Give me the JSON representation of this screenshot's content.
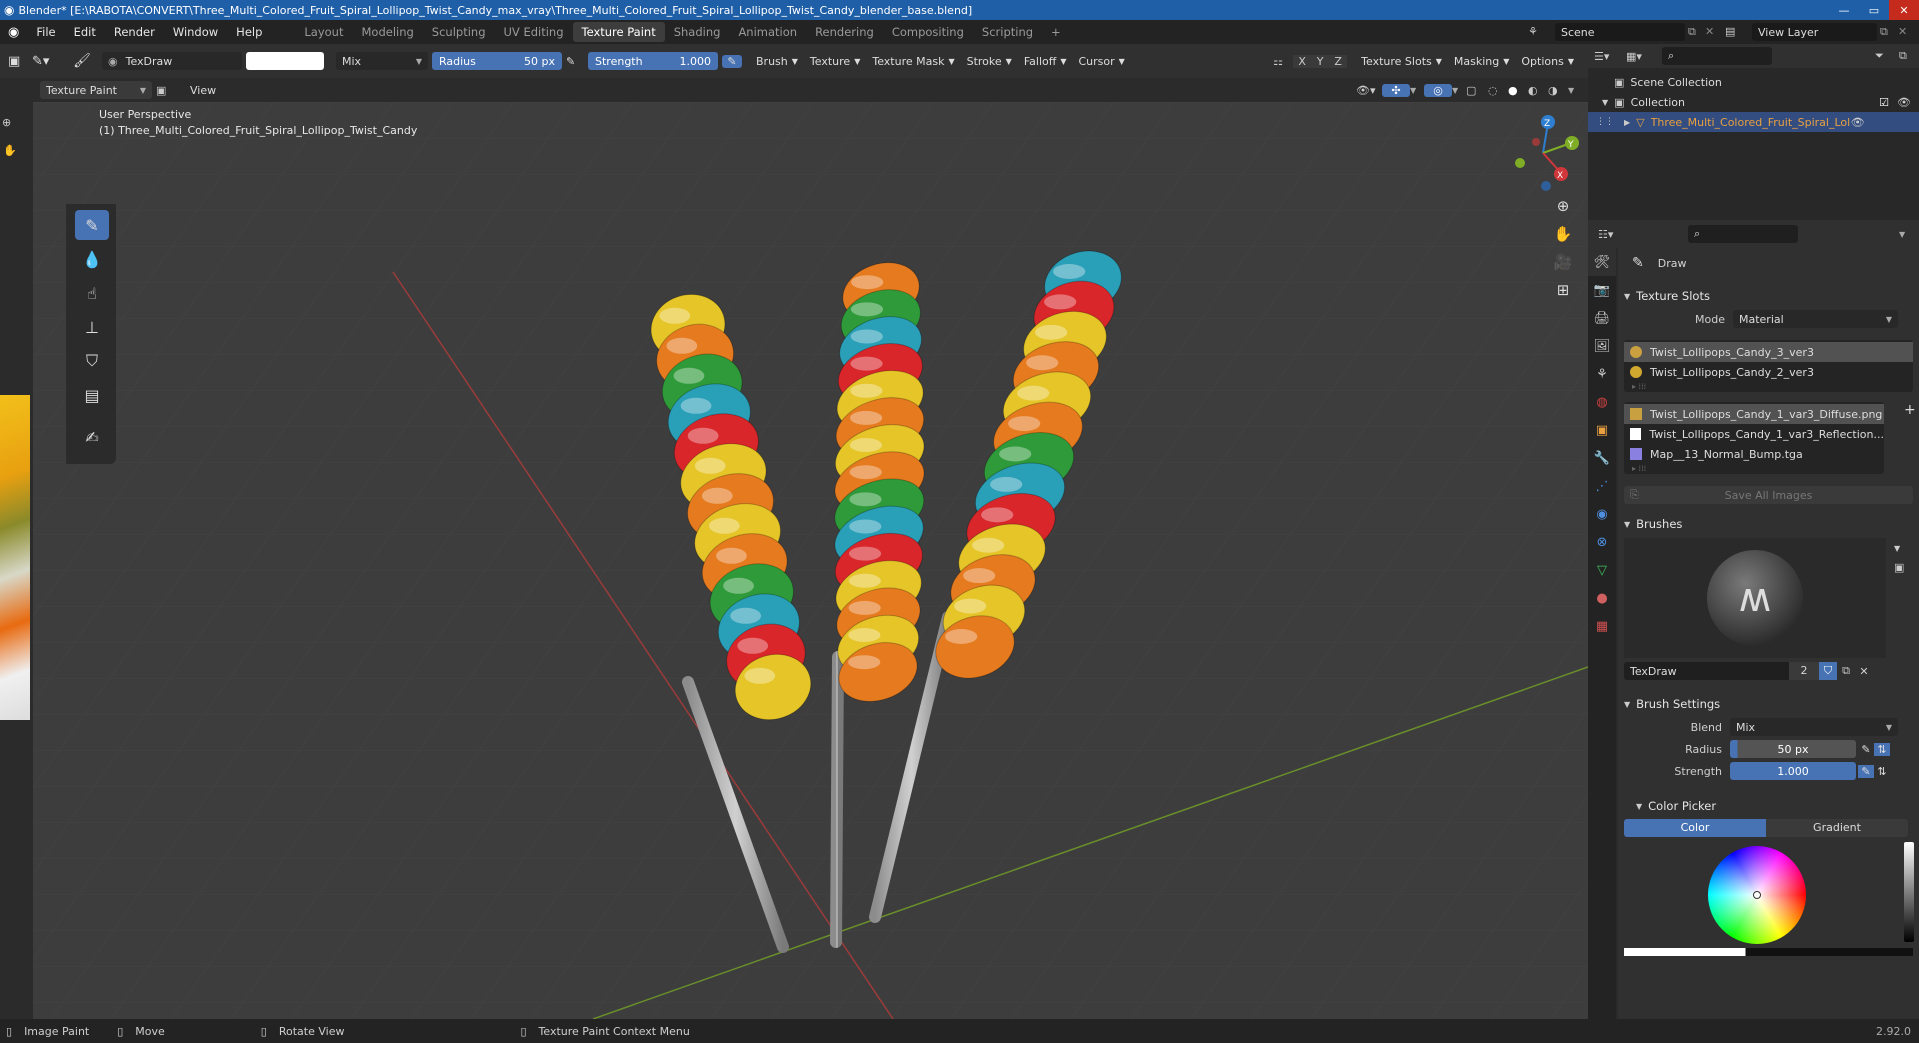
{
  "window": {
    "title": "Blender* [E:\\RABOTA\\CONVERT\\Three_Multi_Colored_Fruit_Spiral_Lollipop_Twist_Candy_max_vray\\Three_Multi_Colored_Fruit_Spiral_Lollipop_Twist_Candy_blender_base.blend]"
  },
  "menu": [
    "File",
    "Edit",
    "Render",
    "Window",
    "Help"
  ],
  "workspaces": [
    "Layout",
    "Modeling",
    "Sculpting",
    "UV Editing",
    "Texture Paint",
    "Shading",
    "Animation",
    "Rendering",
    "Compositing",
    "Scripting"
  ],
  "active_workspace": "Texture Paint",
  "scene": "Scene",
  "view_layer": "View Layer",
  "tool_header": {
    "brush_name": "TexDraw",
    "blend": "Mix",
    "radius_label": "Radius",
    "radius_value": "50 px",
    "strength_label": "Strength",
    "strength_value": "1.000",
    "menus": [
      "Brush",
      "Texture",
      "Texture Mask",
      "Stroke",
      "Falloff",
      "Cursor"
    ],
    "axes": [
      "X",
      "Y",
      "Z"
    ],
    "right_menus": [
      "Texture Slots",
      "Masking",
      "Options"
    ]
  },
  "viewport_header": {
    "mode": "Texture Paint",
    "view": "View"
  },
  "viewport": {
    "perspective": "User Perspective",
    "object": "(1) Three_Multi_Colored_Fruit_Spiral_Lollipop_Twist_Candy",
    "gizmo_axes": [
      "Z",
      "Y",
      "X"
    ]
  },
  "outliner": {
    "scene_collection": "Scene Collection",
    "collection": "Collection",
    "object": "Three_Multi_Colored_Fruit_Spiral_Lollipo"
  },
  "properties": {
    "tool_name": "Draw",
    "texture_slots": {
      "title": "Texture Slots",
      "mode_label": "Mode",
      "mode_value": "Material",
      "materials": [
        {
          "name": "Twist_Lollipops_Candy_3_ver3",
          "color": "#c8a040"
        },
        {
          "name": "Twist_Lollipops_Candy_2_ver3",
          "color": "#d0a830"
        }
      ],
      "images": [
        {
          "name": "Twist_Lollipops_Candy_1_var3_Diffuse.png",
          "color": "#c8a040"
        },
        {
          "name": "Twist_Lollipops_Candy_1_var3_Reflection...",
          "color": "#ffffff"
        },
        {
          "name": "Map__13_Normal_Bump.tga",
          "color": "#8a80e0"
        }
      ],
      "save_all": "Save All Images"
    },
    "brushes": {
      "title": "Brushes",
      "name": "TexDraw",
      "users": "2"
    },
    "brush_settings": {
      "title": "Brush Settings",
      "blend_label": "Blend",
      "blend_value": "Mix",
      "radius_label": "Radius",
      "radius_value": "50 px",
      "strength_label": "Strength",
      "strength_value": "1.000"
    },
    "color_picker": {
      "title": "Color Picker",
      "tab_color": "Color",
      "tab_gradient": "Gradient"
    }
  },
  "status": {
    "items": [
      "Image Paint",
      "Move",
      "Rotate View",
      "Texture Paint Context Menu"
    ],
    "version": "2.92.0"
  },
  "colors": {
    "accent": "#4772b3",
    "title_bar": "#1f5fa8",
    "object_orange": "#e8a040"
  }
}
